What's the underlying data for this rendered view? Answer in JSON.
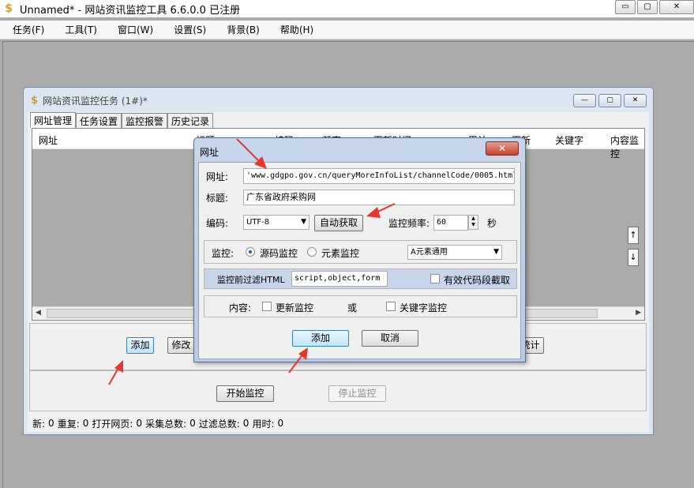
{
  "window": {
    "title": "Unnamed* - 网站资讯监控工具 6.6.0.0 已注册",
    "icon": "dollar-app-icon",
    "minimize_glyph": "▭",
    "restore_glyph": "▢",
    "close_glyph": "✕"
  },
  "menu": [
    {
      "label": "任务(F)"
    },
    {
      "label": "工具(T)"
    },
    {
      "label": "窗口(W)"
    },
    {
      "label": "设置(S)"
    },
    {
      "label": "背景(B)"
    },
    {
      "label": "帮助(H)"
    }
  ],
  "child_window": {
    "title": "网站资讯监控任务 (1#)*",
    "tabs": [
      "网址管理",
      "任务设置",
      "监控报警",
      "历史记录"
    ],
    "active_tab": 0,
    "columns": [
      "网址",
      "标题",
      "编码",
      "频率",
      "更新时间",
      "累计",
      "更新",
      "关键字",
      "内容监控"
    ],
    "side_up": "↑",
    "side_down": "↓",
    "buttons": {
      "add": "添加",
      "edit": "修改",
      "stats": "统计",
      "start": "开始监控",
      "stop": "停止监控"
    },
    "status": {
      "new_label": "新:",
      "new_value": "0",
      "dup_label": "重复:",
      "dup_value": "0",
      "opened_label": "打开网页:",
      "opened_value": "0",
      "collected_label": "采集总数:",
      "collected_value": "0",
      "filtered_label": "过滤总数:",
      "filtered_value": "0",
      "time_label": "用时:",
      "time_value": "0"
    }
  },
  "dialog": {
    "title": "网址",
    "close_glyph": "✕",
    "url_label": "网址:",
    "url_value": "'www.gdgpo.gov.cn/queryMoreInfoList/channelCode/0005.html",
    "title_label": "标题:",
    "title_value": "广东省政府采购网",
    "encoding_label": "编码:",
    "encoding_value": "UTF-8",
    "auto_fetch": "自动获取",
    "freq_label": "监控频率:",
    "freq_value": "60",
    "freq_unit": "秒",
    "monitor_label": "监控:",
    "radio_source": "源码监控",
    "radio_element": "元素监控",
    "element_select": "A元素通用",
    "filter_label": "监控前过滤HTML",
    "filter_value": "script,object,form",
    "valid_code_label": "有效代码段截取",
    "content_label": "内容:",
    "update_monitor": "更新监控",
    "or_label": "或",
    "keyword_monitor": "关键字监控",
    "add_button": "添加",
    "cancel_button": "取消"
  },
  "colors": {
    "annotation_arrow": "#e8372a",
    "dialog_accent": "#b9cbe2",
    "close_button": "#c4432f"
  }
}
